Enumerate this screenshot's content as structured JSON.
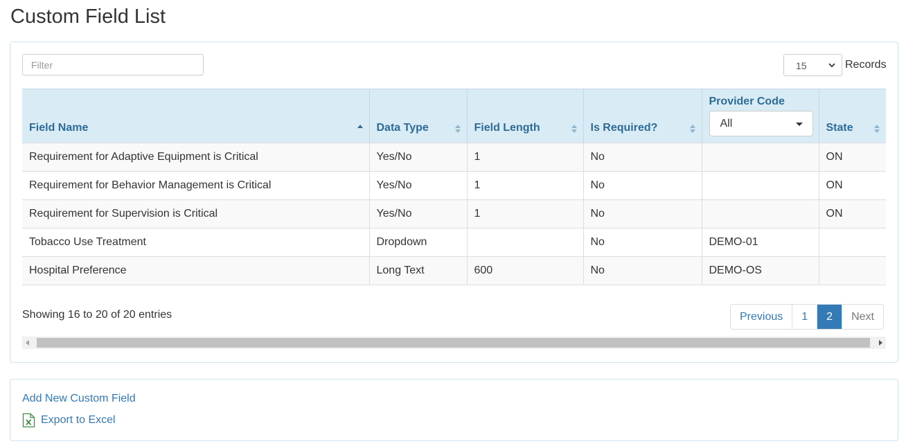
{
  "page": {
    "title": "Custom Field List"
  },
  "filter": {
    "placeholder": "Filter"
  },
  "records": {
    "selected": "15",
    "label": "Records"
  },
  "table": {
    "columns": {
      "field_name": "Field Name",
      "data_type": "Data Type",
      "field_length": "Field Length",
      "is_required": "Is Required?",
      "provider_code": "Provider Code",
      "state": "State"
    },
    "provider_filter": "All",
    "rows": [
      {
        "field_name": "Requirement for Adaptive Equipment is Critical",
        "data_type": "Yes/No",
        "field_length": "1",
        "is_required": "No",
        "provider_code": "",
        "state": "ON"
      },
      {
        "field_name": "Requirement for Behavior Management is Critical",
        "data_type": "Yes/No",
        "field_length": "1",
        "is_required": "No",
        "provider_code": "",
        "state": "ON"
      },
      {
        "field_name": "Requirement for Supervision is Critical",
        "data_type": "Yes/No",
        "field_length": "1",
        "is_required": "No",
        "provider_code": "",
        "state": "ON"
      },
      {
        "field_name": "Tobacco Use Treatment",
        "data_type": "Dropdown",
        "field_length": "",
        "is_required": "No",
        "provider_code": "DEMO-01",
        "state": ""
      },
      {
        "field_name": "Hospital Preference",
        "data_type": "Long Text",
        "field_length": "600",
        "is_required": "No",
        "provider_code": "DEMO-OS",
        "state": ""
      }
    ]
  },
  "info": "Showing 16 to 20 of 20 entries",
  "pagination": {
    "previous": "Previous",
    "pages": [
      "1",
      "2"
    ],
    "active": "2",
    "next": "Next"
  },
  "actions": {
    "add": "Add New Custom Field",
    "export": "Export to Excel"
  },
  "icons": {
    "sort": "sort-icon",
    "sort_asc": "sort-asc-icon",
    "excel": "excel-icon",
    "dropdown": "chevron-down-icon"
  },
  "colors": {
    "link": "#337ab7",
    "header_bg": "#d9ebf5",
    "header_text": "#2e6b97",
    "panel_border": "#cfe4ee"
  }
}
